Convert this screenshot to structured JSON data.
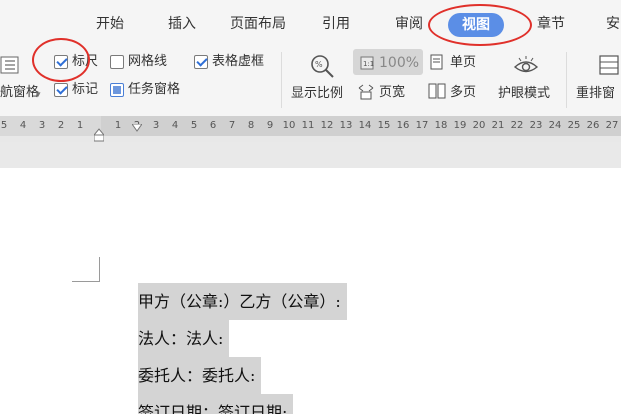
{
  "tabs": [
    {
      "label": "开始"
    },
    {
      "label": "插入"
    },
    {
      "label": "页面布局"
    },
    {
      "label": "引用"
    },
    {
      "label": "审阅"
    },
    {
      "label": "视图",
      "active": true
    },
    {
      "label": "章节"
    },
    {
      "label": "安"
    }
  ],
  "ribbon": {
    "nav_pane_label": "航窗格",
    "ruler_label": "标尺",
    "gridlines_label": "网格线",
    "table_gridlines_label": "表格虚框",
    "marks_label": "标记",
    "task_pane_label": "任务窗格",
    "display_ratio_label": "显示比例",
    "zoom_value": "100%",
    "page_width_label": "页宽",
    "single_page_label": "单页",
    "multi_page_label": "多页",
    "eye_mode_label": "护眼模式",
    "rearrange_label": "重排窗",
    "ruler_checked": true,
    "gridlines_checked": false,
    "table_gridlines_checked": true,
    "marks_checked": true,
    "task_pane_checked": true
  },
  "ruler": {
    "left_numbers": [
      "5",
      "4",
      "3",
      "2",
      "1"
    ],
    "main_numbers": [
      "1",
      "2",
      "3",
      "4",
      "5",
      "6",
      "7",
      "8",
      "9",
      "10",
      "11",
      "12",
      "13",
      "14",
      "15",
      "16",
      "17",
      "18",
      "19",
      "20",
      "21",
      "22",
      "23",
      "24",
      "25",
      "26",
      "27"
    ]
  },
  "document": {
    "lines": [
      "甲方（公章:）乙方（公章）:",
      "法人：法人:",
      "委托人：委托人:",
      "签订日期：签订日期:"
    ]
  },
  "colors": {
    "active_tab": "#5b8ee6",
    "annotation": "#e0302a",
    "highlight": "#d4d4d4"
  }
}
